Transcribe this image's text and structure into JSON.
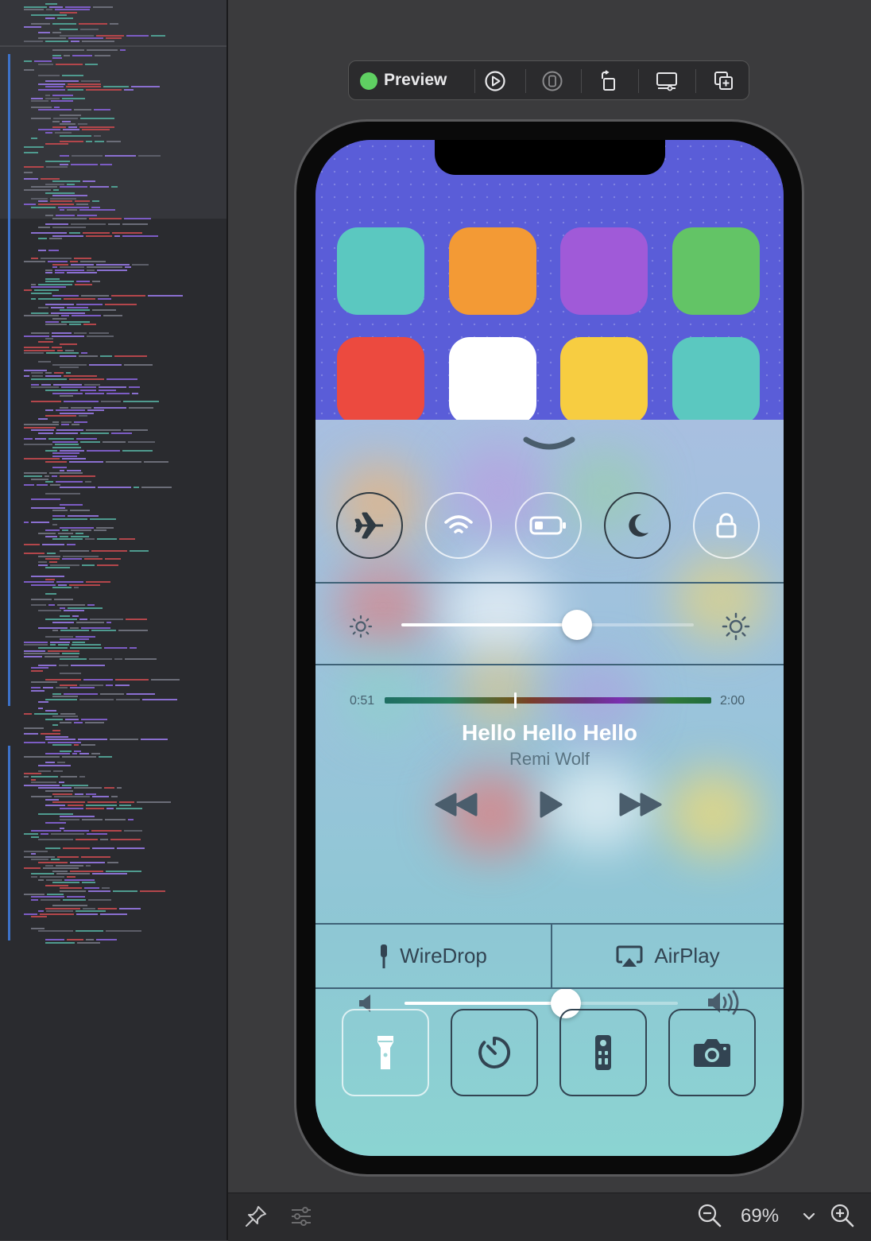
{
  "toolbar": {
    "preview_label": "Preview",
    "status_color": "#5fd062",
    "icons": [
      "live-preview-icon",
      "device-icon",
      "rotate-icon",
      "device-settings-icon",
      "duplicate-icon"
    ]
  },
  "home_screen": {
    "app_colors": [
      "#5bc8c0",
      "#f39a35",
      "#a05ad8",
      "#63c466",
      "#ec4a3f",
      "#ffffff",
      "#f7cd41",
      "#5bc8c0"
    ]
  },
  "control_center": {
    "chevron": "chevron-down-icon",
    "toggles": [
      {
        "name": "airplane-mode",
        "icon": "airplane-icon",
        "state": "on"
      },
      {
        "name": "wifi",
        "icon": "wifi-icon",
        "state": "off"
      },
      {
        "name": "battery",
        "icon": "battery-icon",
        "state": "off"
      },
      {
        "name": "do-not-disturb",
        "icon": "moon-icon",
        "state": "on"
      },
      {
        "name": "rotation-lock",
        "icon": "lock-icon",
        "state": "off"
      }
    ],
    "brightness": {
      "level": 0.6
    },
    "now_playing": {
      "elapsed": "0:51",
      "duration": "2:00",
      "progress": 0.4,
      "title": "Hello Hello Hello",
      "artist": "Remi Wolf"
    },
    "volume": {
      "level": 0.59
    },
    "share_buttons": {
      "wiredrop": "WireDrop",
      "airplay": "AirPlay"
    },
    "shortcuts": [
      {
        "name": "flashlight",
        "icon": "flashlight-icon",
        "state": "off"
      },
      {
        "name": "timer",
        "icon": "timer-icon",
        "state": "on"
      },
      {
        "name": "remote",
        "icon": "remote-icon",
        "state": "on"
      },
      {
        "name": "camera",
        "icon": "camera-icon",
        "state": "on"
      }
    ]
  },
  "bottom_bar": {
    "zoom": "69%"
  }
}
